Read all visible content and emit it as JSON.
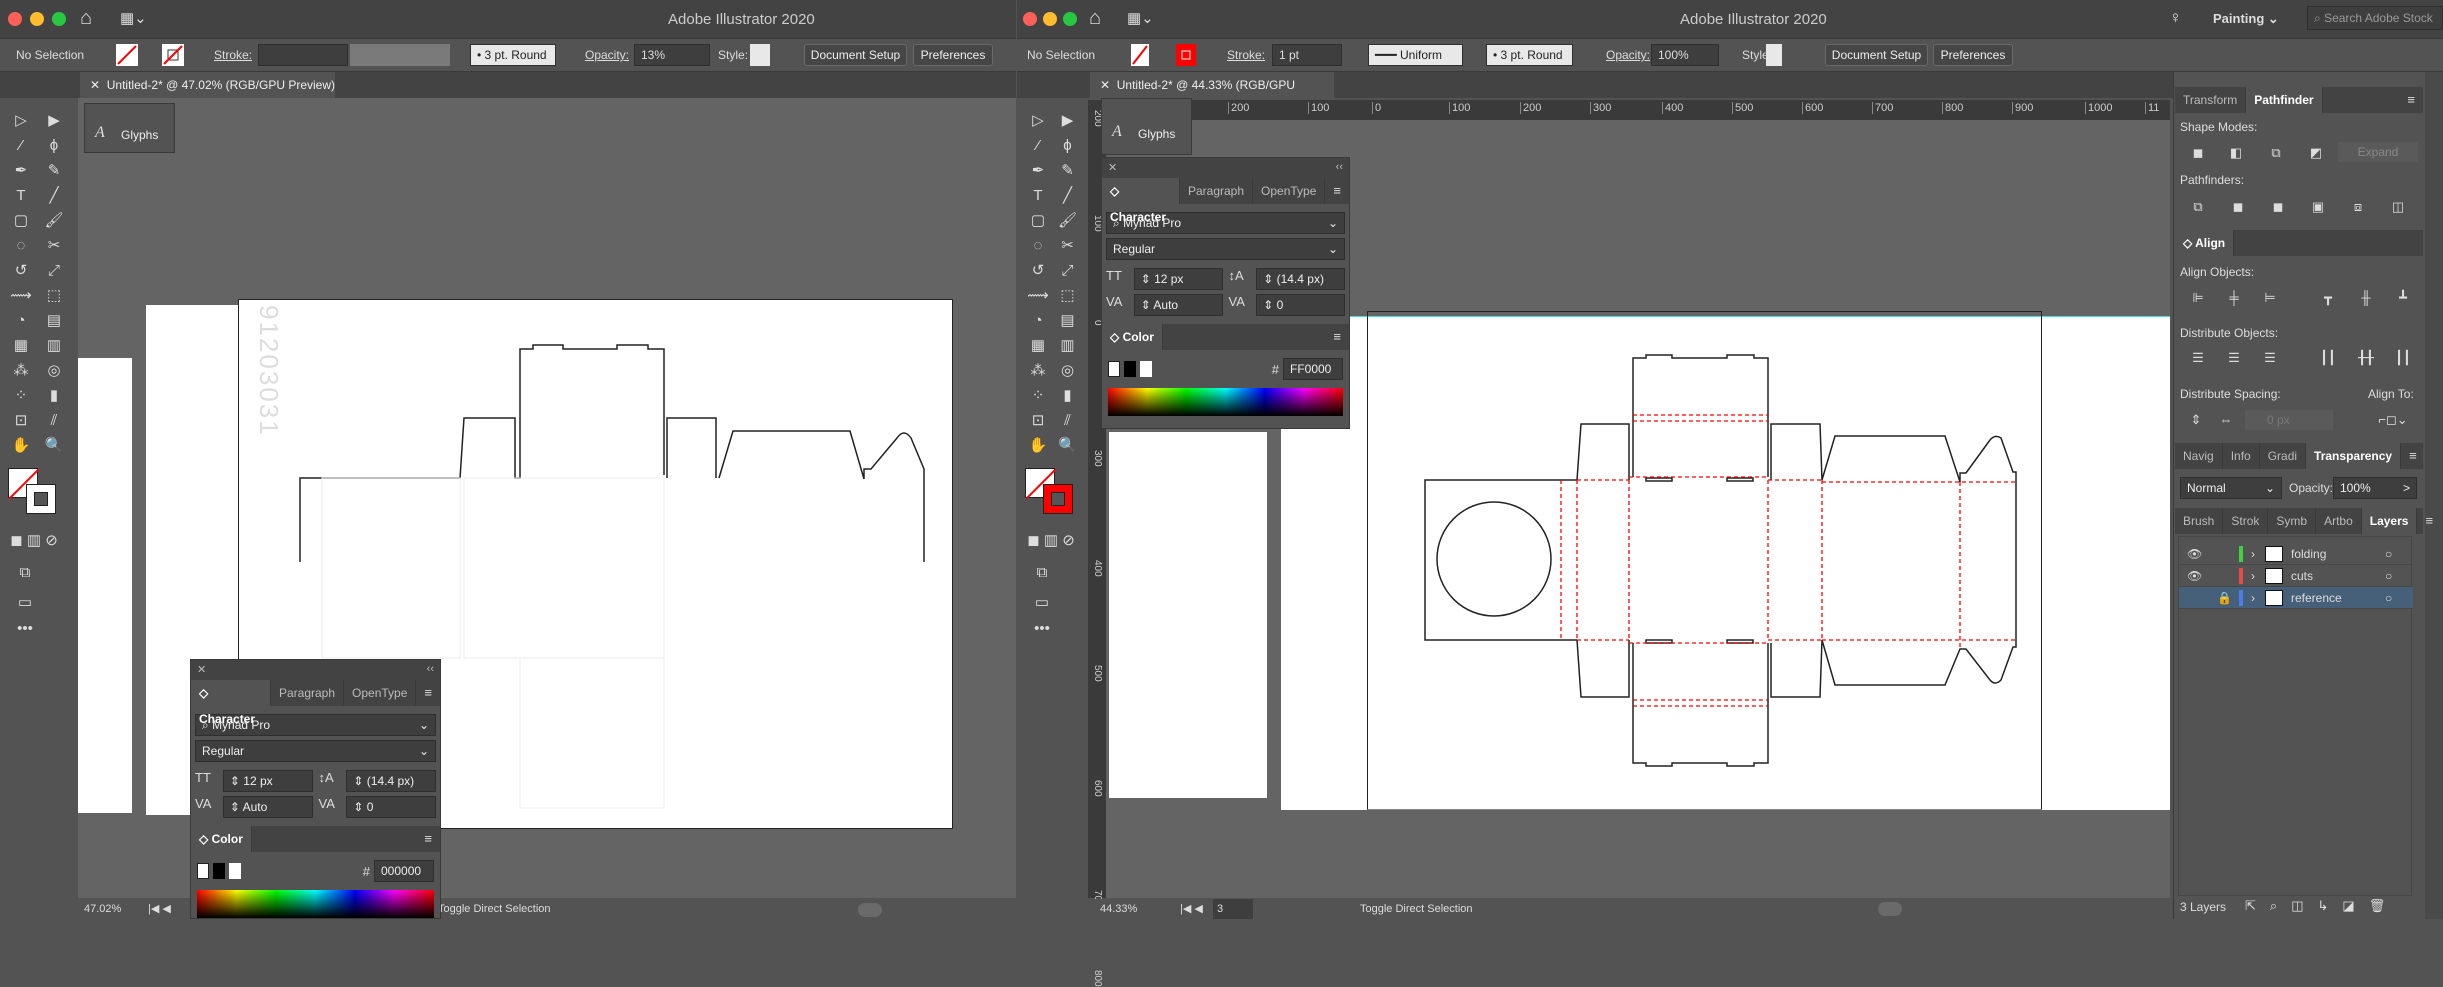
{
  "app_title": "Adobe Illustrator 2020",
  "left_window": {
    "selection": "No Selection",
    "stroke_label": "Stroke:",
    "brush": "3 pt. Round",
    "opacity_label": "Opacity:",
    "opacity": "13%",
    "style_label": "Style:",
    "document_setup": "Document Setup",
    "preferences": "Preferences",
    "doc_tab": "Untitled-2* @ 47.02% (RGB/GPU Preview)",
    "glyphs": "Glyphs",
    "character": {
      "tabs": [
        "Character",
        "Paragraph",
        "OpenType"
      ],
      "font": "Myriad Pro",
      "style": "Regular",
      "size": "12 px",
      "leading": "(14.4 px)",
      "kerning": "Auto",
      "tracking": "0"
    },
    "color": {
      "title": "Color",
      "hex": "000000",
      "hash": "#"
    },
    "status": {
      "zoom": "47.02%",
      "tool": "Toggle Direct Selection"
    },
    "reference_text": "91203031"
  },
  "right_window": {
    "selection": "No Selection",
    "stroke_label": "Stroke:",
    "stroke": "1 pt",
    "profile": "Uniform",
    "brush": "3 pt. Round",
    "opacity_label": "Opacity:",
    "opacity": "100%",
    "style_label": "Style:",
    "document_setup": "Document Setup",
    "preferences": "Preferences",
    "workspace": "Painting",
    "search_placeholder": "Search Adobe Stock",
    "doc_tab": "Untitled-2* @ 44.33% (RGB/GPU Preview)",
    "glyphs": "Glyphs",
    "character": {
      "tabs": [
        "Character",
        "Paragraph",
        "OpenType"
      ],
      "font": "Myriad Pro",
      "style": "Regular",
      "size": "12 px",
      "leading": "(14.4 px)",
      "kerning": "Auto",
      "tracking": "0"
    },
    "color": {
      "title": "Color",
      "hex": "FF0000",
      "hash": "#"
    },
    "ruler_h": [
      "200",
      "100",
      "0",
      "100",
      "200",
      "300",
      "400",
      "500",
      "600",
      "700",
      "800",
      "900",
      "1000",
      "11"
    ],
    "ruler_v": [
      "200",
      "100",
      "0",
      "300",
      "400",
      "500",
      "600",
      "700",
      "800"
    ],
    "status": {
      "zoom": "44.33%",
      "artboard": "3",
      "tool": "Toggle Direct Selection"
    }
  },
  "right_panels": {
    "pathfinder_tabs": [
      "Transform",
      "Pathfinder"
    ],
    "shape_modes": "Shape Modes:",
    "expand": "Expand",
    "pathfinders": "Pathfinders:",
    "align_title": "Align",
    "align_objects": "Align Objects:",
    "distribute_objects": "Distribute Objects:",
    "distribute_spacing": "Distribute Spacing:",
    "align_to": "Align To:",
    "spacing_value": "0 px",
    "transparency_tabs": [
      "Navig",
      "Info",
      "Gradi",
      "Transparency"
    ],
    "blend_mode": "Normal",
    "opacity_label": "Opacity:",
    "opacity": "100%",
    "layers_tabs": [
      "Brush",
      "Strok",
      "Symb",
      "Artbo",
      "Layers"
    ],
    "layers": [
      {
        "name": "folding",
        "color": "#3fd13f",
        "visible": true,
        "locked": false
      },
      {
        "name": "cuts",
        "color": "#e64a4a",
        "visible": true,
        "locked": false
      },
      {
        "name": "reference",
        "color": "#4a7ee6",
        "visible": false,
        "locked": true,
        "selected": true
      }
    ],
    "layer_count": "3 Layers"
  },
  "colors": {
    "cut_line": "#222222",
    "fold_line": "#ff0000",
    "guide": "#3fe0e0",
    "selected_layer": "#46607a"
  }
}
